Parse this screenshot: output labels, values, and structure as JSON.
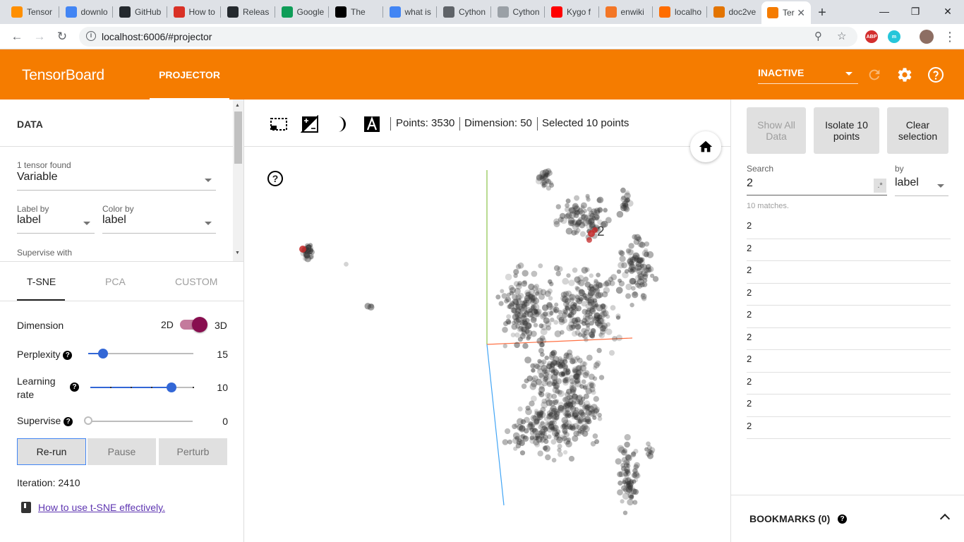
{
  "browser": {
    "tabs": [
      {
        "title": "Tensor",
        "icon": "tensorflow-icon",
        "color": "#ff8f00"
      },
      {
        "title": "downlo",
        "icon": "google-icon",
        "color": "#4285f4"
      },
      {
        "title": "GitHub",
        "icon": "github-icon",
        "color": "#24292e"
      },
      {
        "title": "How to",
        "icon": "gmail-icon",
        "color": "#d93025"
      },
      {
        "title": "Releas",
        "icon": "github-icon",
        "color": "#24292e"
      },
      {
        "title": "Google",
        "icon": "drive-icon",
        "color": "#0f9d58"
      },
      {
        "title": "The",
        "icon": "medium-icon",
        "color": "#000000"
      },
      {
        "title": "what is",
        "icon": "google-icon",
        "color": "#4285f4"
      },
      {
        "title": "Cython",
        "icon": "cython-icon",
        "color": "#5f6368"
      },
      {
        "title": "Cython",
        "icon": "cube-icon",
        "color": "#9aa0a6"
      },
      {
        "title": "Kygo f",
        "icon": "youtube-icon",
        "color": "#ff0000"
      },
      {
        "title": "enwiki",
        "icon": "jupyter-icon",
        "color": "#f37626"
      },
      {
        "title": "localho",
        "icon": "terminal-icon",
        "color": "#ff6d00"
      },
      {
        "title": "doc2ve",
        "icon": "document-icon",
        "color": "#e37400"
      },
      {
        "title": "Ter",
        "icon": "tensorboard-icon",
        "color": "#f57c00",
        "active": true
      }
    ],
    "new_tab_label": "+",
    "url": "localhost:6006/#projector",
    "extensions": [
      {
        "label": "ABP",
        "color": "#d32f2f"
      },
      {
        "label": "m",
        "color": "#26c6da"
      }
    ]
  },
  "header": {
    "brand": "TensorBoard",
    "nav_tab": "PROJECTOR",
    "run_status": "INACTIVE"
  },
  "left": {
    "data_title": "DATA",
    "tensors_found": "1 tensor found",
    "tensor_value": "Variable",
    "label_by_label": "Label by",
    "label_by_value": "label",
    "color_by_label": "Color by",
    "color_by_value": "label",
    "supervise_with_label": "Supervise with",
    "algo_tabs": [
      "T-SNE",
      "PCA",
      "CUSTOM"
    ],
    "dimension_label": "Dimension",
    "dim_2d": "2D",
    "dim_3d": "3D",
    "perplexity_label": "Perplexity",
    "perplexity_value": "15",
    "learning_rate_label": "Learning rate",
    "learning_rate_value": "10",
    "supervise_label": "Supervise",
    "supervise_value": "0",
    "buttons": {
      "rerun": "Re-run",
      "pause": "Pause",
      "perturb": "Perturb"
    },
    "iteration": "Iteration: 2410",
    "help_link": "How to use t-SNE effectively.",
    "slider_levels": {
      "perplexity": 0.14,
      "learning_rate": 0.79,
      "supervise": 0.0
    }
  },
  "center": {
    "stats": {
      "points": "Points: 3530",
      "dimension": "Dimension: 50",
      "selected": "Selected 10 points"
    },
    "help_symbol": "?",
    "cluster_labels": [
      "2",
      "2"
    ]
  },
  "right": {
    "show_all": "Show All Data",
    "isolate": "Isolate 10 points",
    "clear": "Clear selection",
    "search_label": "Search",
    "search_value": "2",
    "regex_label": ".*",
    "by_label": "by",
    "by_value": "label",
    "matches_text": "10 matches.",
    "matches": [
      "2",
      "2",
      "2",
      "2",
      "2",
      "2",
      "2",
      "2",
      "2",
      "2"
    ],
    "bookmarks": "BOOKMARKS (0)"
  },
  "colors": {
    "header_orange": "#f57c00",
    "accent_blue": "#3367d6",
    "toggle_magenta": "#880e4f",
    "selected_red": "#c62828"
  }
}
